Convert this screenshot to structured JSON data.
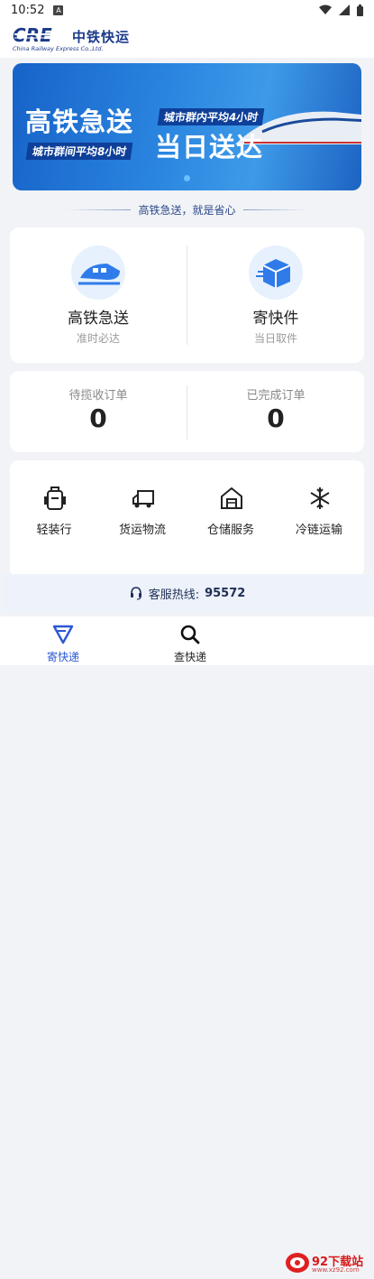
{
  "status_bar": {
    "time": "10:52",
    "badge": "A"
  },
  "header": {
    "logo_text": "CRE",
    "logo_cn": "中铁快运",
    "logo_en": "China Railway Express Co.,Ltd."
  },
  "banner": {
    "title1": "高铁急送",
    "sub1": "城市群内平均4小时",
    "sub2": "城市群间平均8小时",
    "title2": "当日送达"
  },
  "slogan": "高铁急送，就是省心",
  "services": [
    {
      "name": "高铁急送",
      "desc": "准时必达",
      "icon": "high-speed-train-icon"
    },
    {
      "name": "寄快件",
      "desc": "当日取件",
      "icon": "parcel-box-icon"
    }
  ],
  "orders": [
    {
      "label": "待揽收订单",
      "count": "0"
    },
    {
      "label": "已完成订单",
      "count": "0"
    }
  ],
  "tools": [
    {
      "label": "轻装行",
      "icon": "backpack-icon"
    },
    {
      "label": "货运物流",
      "icon": "truck-icon"
    },
    {
      "label": "仓储服务",
      "icon": "warehouse-icon"
    },
    {
      "label": "冷链运输",
      "icon": "snowflake-icon"
    }
  ],
  "hotline": {
    "label": "客服热线:",
    "number": "95572"
  },
  "tabbar": [
    {
      "label": "寄快递",
      "icon": "send-icon",
      "active": true
    },
    {
      "label": "查快递",
      "icon": "search-icon",
      "active": false
    }
  ],
  "watermark": {
    "text": "92下载站",
    "url": "www.xz92.com"
  },
  "colors": {
    "primary": "#2a57d3",
    "brand_dark": "#1b3a8a",
    "banner_blue": "#2b86e0"
  }
}
